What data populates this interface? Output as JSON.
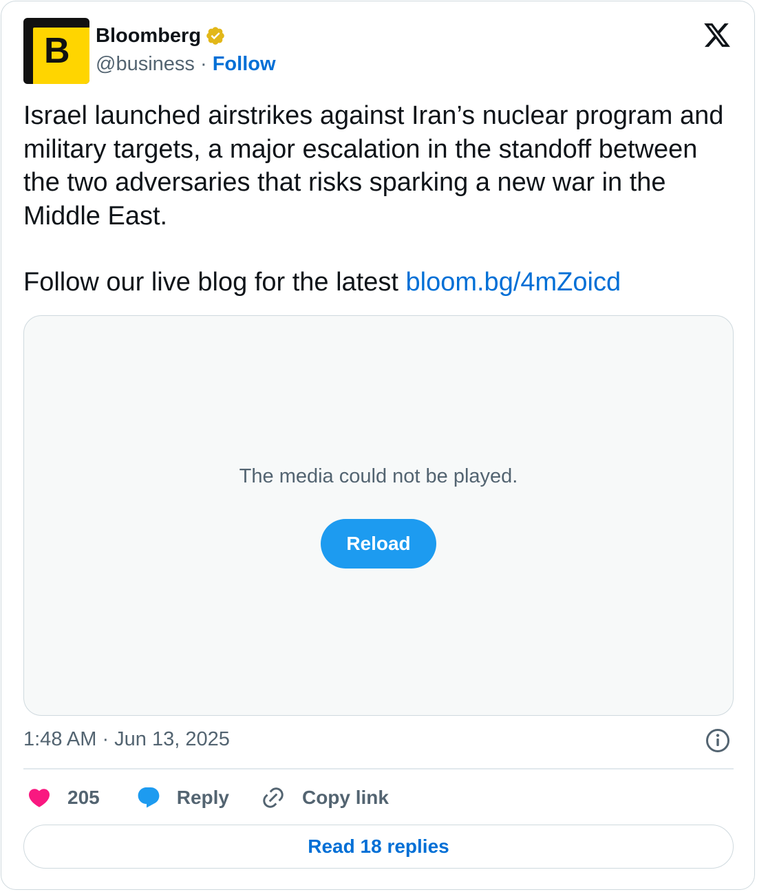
{
  "author": {
    "avatar_letter": "B",
    "name": "Bloomberg",
    "verified": true,
    "handle": "@business",
    "separator": "·",
    "follow_label": "Follow"
  },
  "tweet": {
    "paragraph_1": "Israel launched airstrikes against Iran’s nuclear program and military targets, a major escalation in the standoff between the two adversaries that risks sparking a new war in the Middle East.",
    "paragraph_2_text": "Follow our live blog for the latest ",
    "paragraph_2_link": "bloom.bg/4mZoicd"
  },
  "media": {
    "error_message": "The media could not be played.",
    "reload_label": "Reload"
  },
  "timestamp": "1:48 AM · Jun 13, 2025",
  "actions": {
    "like_count": "205",
    "reply_label": "Reply",
    "copy_link_label": "Copy link"
  },
  "read_replies_label": "Read 18 replies",
  "colors": {
    "accent": "#1d9bf0",
    "link": "#006fd6",
    "heart": "#f91880",
    "avatar_yellow": "#ffd500"
  },
  "icons": {
    "verified": "verified-badge-icon",
    "brand": "x-logo-icon",
    "info": "info-icon",
    "like": "heart-icon",
    "reply": "speech-bubble-icon",
    "copy": "link-icon"
  }
}
